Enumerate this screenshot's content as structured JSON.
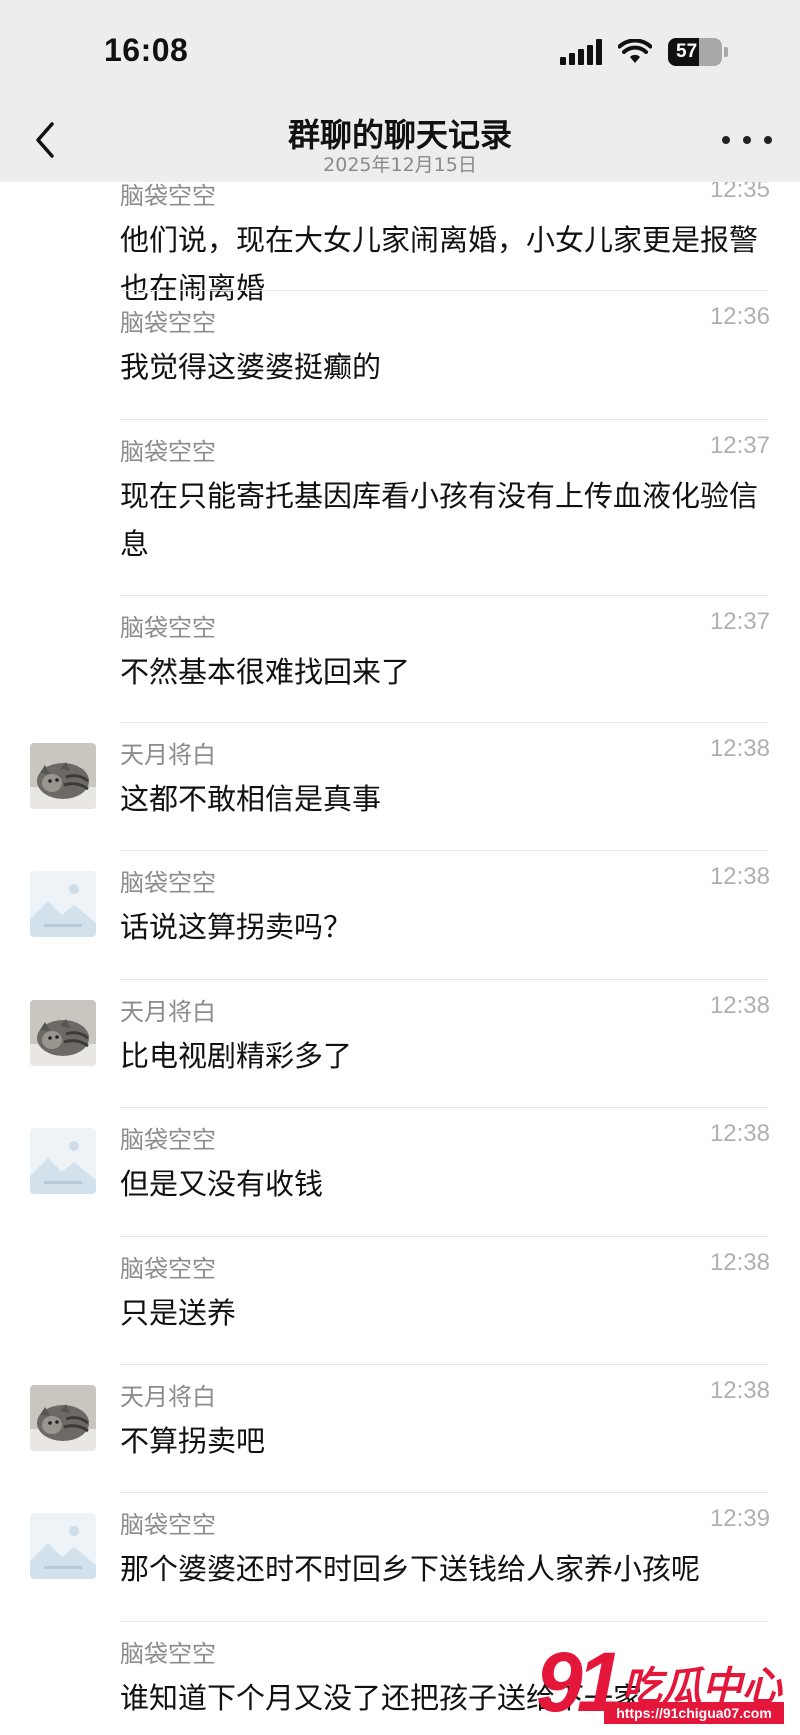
{
  "status_bar": {
    "time": "16:08",
    "battery_level": "57",
    "battery_fraction": 0.57
  },
  "nav": {
    "title": "群聊的聊天记录",
    "date": "2025年12月15日"
  },
  "messages": [
    {
      "sender": "脑袋空空",
      "time": "12:35",
      "text": "他们说，现在大女儿家闹离婚，小女儿家更是报警也在闹离婚",
      "avatar": "none",
      "height": 127
    },
    {
      "sender": "脑袋空空",
      "time": "12:36",
      "text": "我觉得这婆婆挺癫的",
      "avatar": "none",
      "height": 129
    },
    {
      "sender": "脑袋空空",
      "time": "12:37",
      "text": "现在只能寄托基因库看小孩有没有上传血液化验信息",
      "avatar": "none",
      "height": 176
    },
    {
      "sender": "脑袋空空",
      "time": "12:37",
      "text": "不然基本很难找回来了",
      "avatar": "none",
      "height": 127
    },
    {
      "sender": "天月将白",
      "time": "12:38",
      "text": "这都不敢相信是真事",
      "avatar": "cat-photo",
      "height": 128
    },
    {
      "sender": "脑袋空空",
      "time": "12:38",
      "text": "话说这算拐卖吗？",
      "avatar": "placeholder-image",
      "height": 129
    },
    {
      "sender": "天月将白",
      "time": "12:38",
      "text": "比电视剧精彩多了",
      "avatar": "cat-photo",
      "height": 128
    },
    {
      "sender": "脑袋空空",
      "time": "12:38",
      "text": "但是又没有收钱",
      "avatar": "placeholder-image",
      "height": 129
    },
    {
      "sender": "脑袋空空",
      "time": "12:38",
      "text": "只是送养",
      "avatar": "none",
      "height": 128
    },
    {
      "sender": "天月将白",
      "time": "12:38",
      "text": "不算拐卖吧",
      "avatar": "cat-photo",
      "height": 128
    },
    {
      "sender": "脑袋空空",
      "time": "12:39",
      "text": "那个婆婆还时不时回乡下送钱给人家养小孩呢",
      "avatar": "placeholder-image",
      "height": 129
    },
    {
      "sender": "脑袋空空",
      "time": "",
      "text": "谁知道下个月又没了还把孩子送给下一家",
      "avatar": "none",
      "height": 129
    }
  ],
  "watermark": {
    "number": "91",
    "name": "吃瓜中心",
    "url": "https://91chigua07.com"
  }
}
